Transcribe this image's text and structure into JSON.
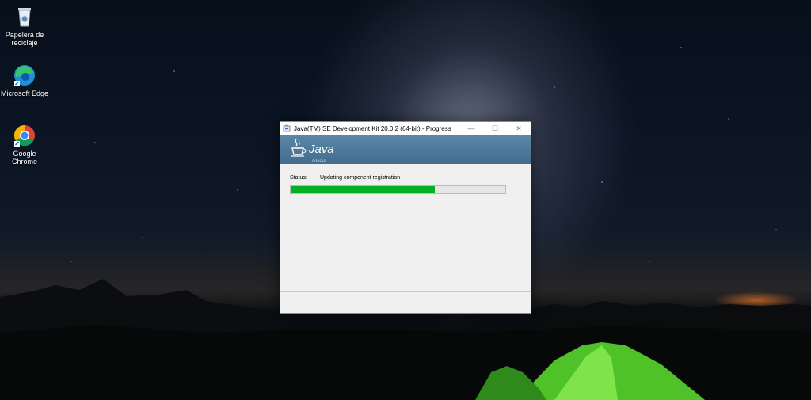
{
  "desktop": {
    "icons": [
      {
        "label": "Papelera de reciclaje",
        "icon": "recycle-bin-icon"
      },
      {
        "label": "Microsoft Edge",
        "icon": "edge-icon"
      },
      {
        "label": "Google Chrome",
        "icon": "chrome-icon"
      }
    ]
  },
  "window": {
    "title": "Java(TM) SE Development Kit 20.0.2 (64-bit) - Progress",
    "controls": {
      "minimize": "—",
      "maximize": "☐",
      "close": "✕"
    },
    "banner": {
      "logo_text": "Java",
      "sub_text": "ORACLE"
    },
    "status_label": "Status:",
    "status_text": "Updating component registration",
    "progress_fraction": 0.67,
    "progress_color": "#06b025"
  }
}
